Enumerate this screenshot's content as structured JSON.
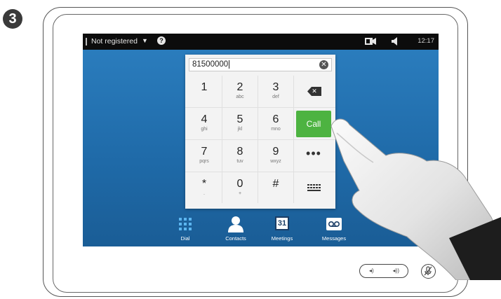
{
  "step_number": "3",
  "status_bar": {
    "registration": "Not registered",
    "dropdown_arrow": "▼",
    "help": "?",
    "time": "12:17",
    "icons": [
      "selfview-camera-icon",
      "speaker-icon"
    ]
  },
  "dialer": {
    "input_value": "81500000",
    "keys": [
      {
        "digit": "1",
        "letters": ""
      },
      {
        "digit": "2",
        "letters": "abc"
      },
      {
        "digit": "3",
        "letters": "def"
      },
      {
        "digit": "4",
        "letters": "ghi"
      },
      {
        "digit": "5",
        "letters": "jkl"
      },
      {
        "digit": "6",
        "letters": "mno"
      },
      {
        "digit": "7",
        "letters": "pqrs"
      },
      {
        "digit": "8",
        "letters": "tuv"
      },
      {
        "digit": "9",
        "letters": "wxyz"
      },
      {
        "digit": "*",
        "letters": "."
      },
      {
        "digit": "0",
        "letters": "+"
      },
      {
        "digit": "#",
        "letters": ""
      }
    ],
    "call_label": "Call",
    "more_label": "•••"
  },
  "tabs": [
    {
      "label": "Dial",
      "icon": "dial-grid-icon"
    },
    {
      "label": "Contacts",
      "icon": "contacts-icon"
    },
    {
      "label": "Meetings",
      "icon": "calendar-icon",
      "calendar_day": "31"
    },
    {
      "label": "Messages",
      "icon": "voicemail-icon"
    }
  ],
  "colors": {
    "screen_blue": "#2474b5",
    "call_green": "#4db341",
    "status_bar": "#0c0c0c"
  }
}
